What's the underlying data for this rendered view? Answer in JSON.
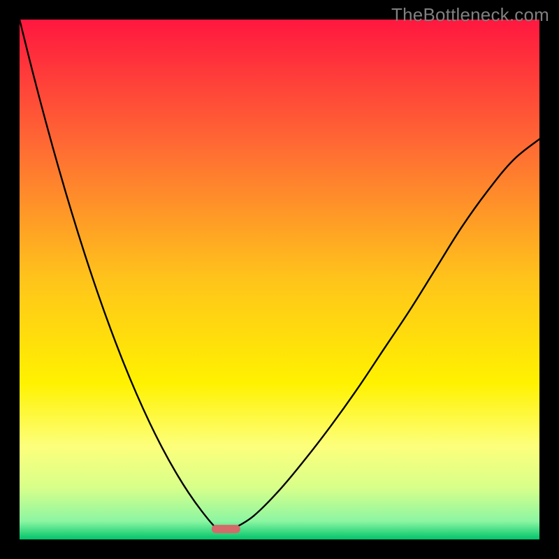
{
  "watermark": "TheBottleneck.com",
  "chart_data": {
    "type": "line",
    "title": "",
    "xlabel": "",
    "ylabel": "",
    "xlim": [
      0,
      100
    ],
    "ylim": [
      0,
      100
    ],
    "grid": false,
    "legend": false,
    "background_gradient_stops": [
      {
        "offset": 0.0,
        "color": "#ff173f"
      },
      {
        "offset": 0.25,
        "color": "#ff6d33"
      },
      {
        "offset": 0.5,
        "color": "#ffc41b"
      },
      {
        "offset": 0.7,
        "color": "#fff200"
      },
      {
        "offset": 0.82,
        "color": "#fdff7b"
      },
      {
        "offset": 0.9,
        "color": "#d8ff8a"
      },
      {
        "offset": 0.965,
        "color": "#8cf6a2"
      },
      {
        "offset": 1.0,
        "color": "#00c46a"
      }
    ],
    "series": [
      {
        "name": "left-branch",
        "color": "#000000",
        "x": [
          0.0,
          2.5,
          5.0,
          7.5,
          10.0,
          12.5,
          15.0,
          17.5,
          20.0,
          22.5,
          25.0,
          27.5,
          30.0,
          32.5,
          35.0,
          37.5,
          38.5
        ],
        "y": [
          100.0,
          90.0,
          80.5,
          71.5,
          63.0,
          55.0,
          47.5,
          40.5,
          34.0,
          28.0,
          22.5,
          17.5,
          13.0,
          9.0,
          5.5,
          2.5,
          2.0
        ]
      },
      {
        "name": "right-branch",
        "color": "#000000",
        "x": [
          41.0,
          45.0,
          50.0,
          55.0,
          60.0,
          65.0,
          70.0,
          75.0,
          80.0,
          85.0,
          90.0,
          95.0,
          100.0
        ],
        "y": [
          2.0,
          4.5,
          9.5,
          15.5,
          22.0,
          29.0,
          36.5,
          44.0,
          52.0,
          60.0,
          67.0,
          73.0,
          77.0
        ]
      }
    ],
    "marker": {
      "name": "bottom-pill",
      "shape": "rounded-rect",
      "color": "#d46a6a",
      "x_center": 39.7,
      "y_center": 2.0,
      "width_units": 5.5,
      "height_units": 1.6
    }
  }
}
